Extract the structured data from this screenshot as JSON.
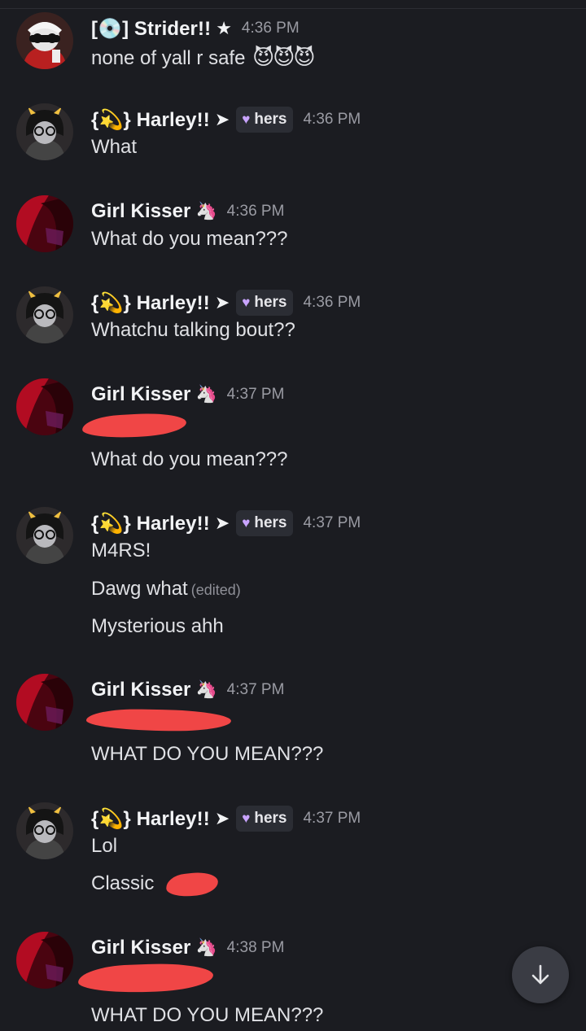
{
  "messages": [
    {
      "author": "[💿] Strider!!",
      "glyph": "★",
      "time": "4:36 PM",
      "lines": [
        "none of yall r safe"
      ],
      "devils": "😈😈😈"
    },
    {
      "author": "{💫} Harley!!",
      "glyph": "➤",
      "pronoun": "hers",
      "time": "4:36 PM",
      "lines": [
        "What"
      ]
    },
    {
      "author": "Girl Kisser",
      "emoji": "🦄",
      "time": "4:36 PM",
      "lines": [
        "What do you mean???"
      ]
    },
    {
      "author": "{💫} Harley!!",
      "glyph": "➤",
      "pronoun": "hers",
      "time": "4:36 PM",
      "lines": [
        "Whatchu talking bout??"
      ]
    },
    {
      "author": "Girl Kisser",
      "emoji": "🦄",
      "time": "4:37 PM",
      "lines": [
        "What do you mean???"
      ]
    },
    {
      "author": "{💫} Harley!!",
      "glyph": "➤",
      "pronoun": "hers",
      "time": "4:37 PM",
      "lines": [
        "M4RS!",
        "Dawg what",
        "Mysterious ahh"
      ],
      "edited": "(edited)"
    },
    {
      "author": "Girl Kisser",
      "emoji": "🦄",
      "time": "4:37 PM",
      "lines": [
        "WHAT DO YOU MEAN???"
      ]
    },
    {
      "author": "{💫} Harley!!",
      "glyph": "➤",
      "pronoun": "hers",
      "time": "4:37 PM",
      "lines": [
        "Lol",
        "Classic"
      ]
    },
    {
      "author": "Girl Kisser",
      "emoji": "🦄",
      "time": "4:38 PM",
      "lines": [
        "WHAT DO YOU MEAN???"
      ]
    }
  ],
  "colors": {
    "background": "#1b1c21",
    "pronoun_heart": "#c9a4ff",
    "redaction": "#f04646"
  },
  "icons": {
    "scroll_down": "arrow-down-icon",
    "pronoun": "heart-icon"
  }
}
